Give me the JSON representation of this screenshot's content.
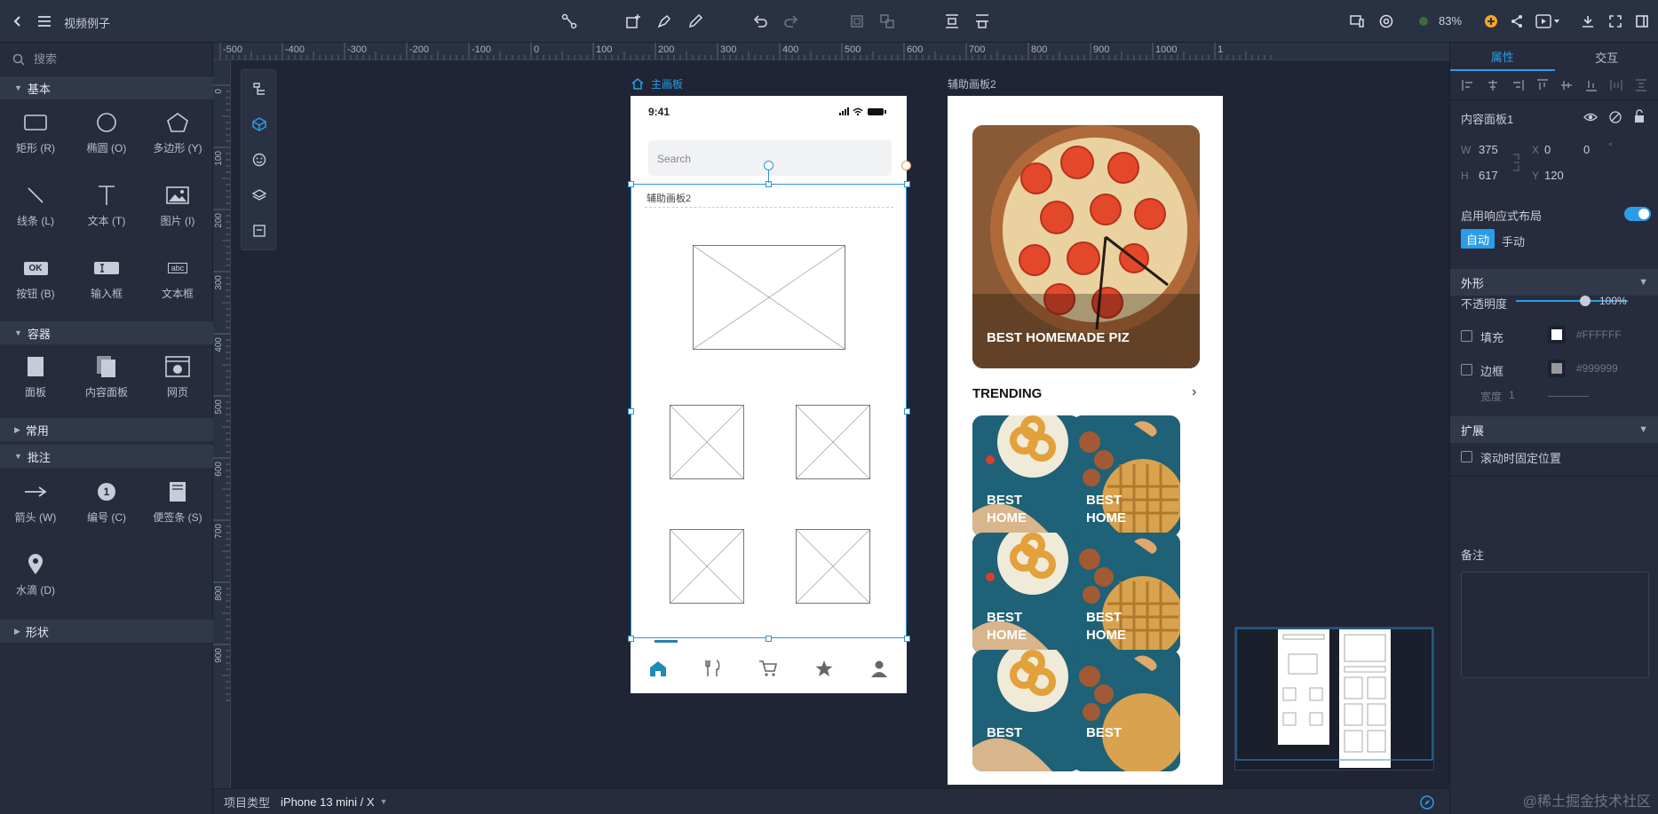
{
  "header": {
    "title": "视频例子",
    "zoom": "83%"
  },
  "left": {
    "search_placeholder": "搜索",
    "categories": {
      "basic": "基本",
      "container": "容器",
      "common": "常用",
      "annotation": "批注",
      "shape": "形状"
    },
    "basic_tools": [
      "矩形 (R)",
      "椭圆 (O)",
      "多边形 (Y)",
      "线条 (L)",
      "文本 (T)",
      "图片 (I)",
      "按钮 (B)",
      "输入框",
      "文本框"
    ],
    "button_icon_text": "OK",
    "textbox_icon_text": "abc",
    "container_tools": [
      "面板",
      "内容面板",
      "网页"
    ],
    "annotation_tools": [
      "箭头 (W)",
      "编号 (C)",
      "便签条 (S)",
      "水滴 (D)"
    ],
    "number_icon_text": "1"
  },
  "rulers": {
    "h_labels": [
      "-500",
      "-400",
      "-300",
      "-200",
      "-100",
      "0",
      "100",
      "200",
      "300",
      "400",
      "500",
      "600",
      "700",
      "800",
      "900",
      "1000",
      "1"
    ],
    "v_labels": [
      "0",
      "100",
      "200",
      "300",
      "400",
      "500",
      "600",
      "700",
      "800",
      "900"
    ]
  },
  "canvas": {
    "main_board_label": "主画板",
    "board2_label": "辅助画板2",
    "phone": {
      "time": "9:41",
      "search_placeholder": "Search",
      "embedded_label": "辅助画板2"
    },
    "board2": {
      "hero_title": "BEST HOMEMADE PIZ",
      "trending": "TRENDING",
      "card_title": [
        "BEST",
        "HOME"
      ],
      "card_title_partial": "BEST"
    }
  },
  "right": {
    "tabs": [
      "属性",
      "交互"
    ],
    "component_name": "内容面板1",
    "w_label": "W",
    "w": "375",
    "h_label": "H",
    "h": "617",
    "x_label": "X",
    "x": "0",
    "y_label": "Y",
    "y": "120",
    "rotation": "0",
    "degree": "°",
    "responsive_label": "启用响应式布局",
    "mode_auto": "自动",
    "mode_manual": "手动",
    "appearance": "外形",
    "opacity_label": "不透明度",
    "opacity_value": "100%",
    "fill_label": "填充",
    "fill_value": "#FFFFFF",
    "border_label": "边框",
    "border_value": "#999999",
    "width_label": "宽度",
    "width_value": "1",
    "extend": "扩展",
    "fixed_scroll": "滚动时固定位置",
    "notes": "备注"
  },
  "bottom": {
    "project_type_label": "项目类型",
    "device": "iPhone 13 mini / X"
  },
  "watermark": "@稀土掘金技术社区",
  "colors": {
    "accent": "#2a9dea",
    "selection": "#2f92d6",
    "bg": "#1f2534",
    "panel": "#262c3b",
    "teal": "#1f6176",
    "orange": "#f5a623"
  }
}
